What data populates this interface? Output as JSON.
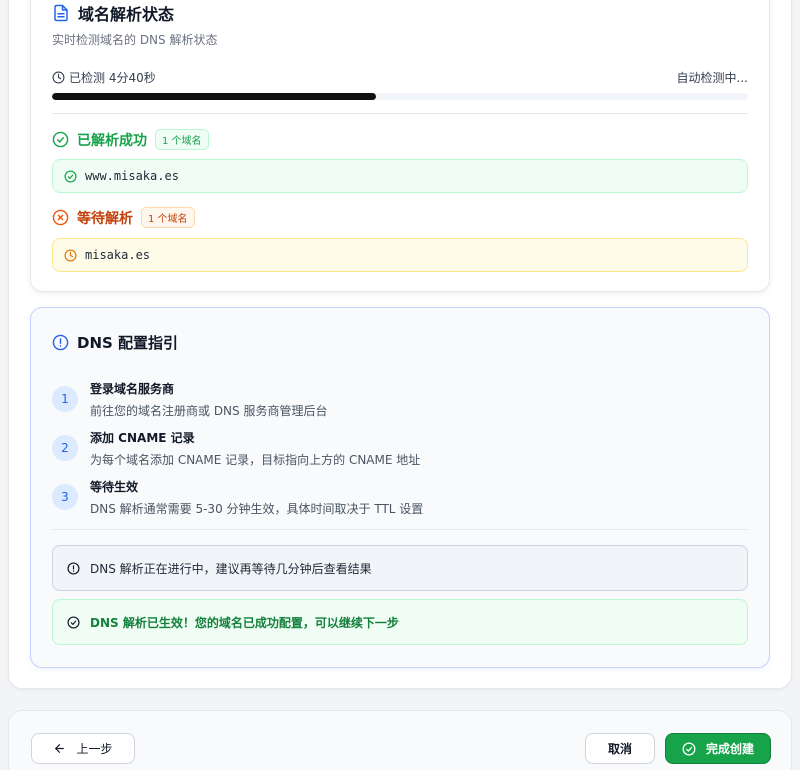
{
  "status_card": {
    "title": "域名解析状态",
    "subtitle": "实时检测域名的 DNS 解析状态",
    "elapsed": "已检测 4分40秒",
    "auto_status": "自动检测中...",
    "progress_fraction": 0.465,
    "resolved": {
      "label": "已解析成功",
      "count_badge": "1 个域名",
      "domains": [
        "www.misaka.es"
      ]
    },
    "pending": {
      "label": "等待解析",
      "count_badge": "1 个域名",
      "domains": [
        "misaka.es"
      ]
    }
  },
  "guide_card": {
    "title": "DNS 配置指引",
    "steps": [
      {
        "num": "1",
        "title": "登录域名服务商",
        "desc": "前往您的域名注册商或 DNS 服务商管理后台"
      },
      {
        "num": "2",
        "title": "添加 CNAME 记录",
        "desc": "为每个域名添加 CNAME 记录，目标指向上方的 CNAME 地址"
      },
      {
        "num": "3",
        "title": "等待生效",
        "desc": "DNS 解析通常需要 5-30 分钟生效，具体时间取决于 TTL 设置"
      }
    ],
    "info_notice": "DNS 解析正在进行中，建议再等待几分钟后查看结果",
    "success_notice": "DNS 解析已生效！您的域名已成功配置，可以继续下一步"
  },
  "footer": {
    "back_label": "上一步",
    "cancel_label": "取消",
    "finish_label": "完成创建"
  },
  "colors": {
    "success": "#16a34a",
    "warning": "#ea580c",
    "accent": "#2563eb"
  }
}
